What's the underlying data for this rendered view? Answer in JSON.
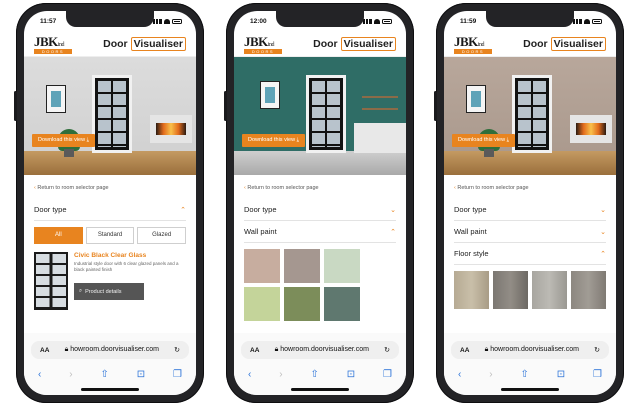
{
  "colors": {
    "accent": "#e8841f"
  },
  "logo": {
    "main": "JBK",
    "sub": "ind",
    "doors": "DOORS"
  },
  "brand": {
    "door": "Door",
    "visualiser": "Visualiser"
  },
  "download_label": "Download this view",
  "back_label": "Return to room selector page",
  "url": "howroom.doorvisualiser.com",
  "aa": "AA",
  "phones": [
    {
      "time": "11:57",
      "door_type_label": "Door type",
      "filters": [
        "All",
        "Standard",
        "Glazed"
      ],
      "product_name": "Civic Black Clear Glass",
      "product_desc": "Industrial style door with 6 clear glazed panels and a black painted finish",
      "product_button": "Product details"
    },
    {
      "time": "12:00",
      "door_type_label": "Door type",
      "wall_paint_label": "Wall paint",
      "swatches": [
        "#c7ad9f",
        "#a59790",
        "#c9d9c3",
        "#c4d49a",
        "#7c8d5a",
        "#5f786f"
      ]
    },
    {
      "time": "11:59",
      "door_type_label": "Door type",
      "wall_paint_label": "Wall paint",
      "floor_style_label": "Floor style",
      "floors": [
        "#b6aa93",
        "#7b7772",
        "#a8a6a0",
        "#8c8780"
      ]
    }
  ]
}
